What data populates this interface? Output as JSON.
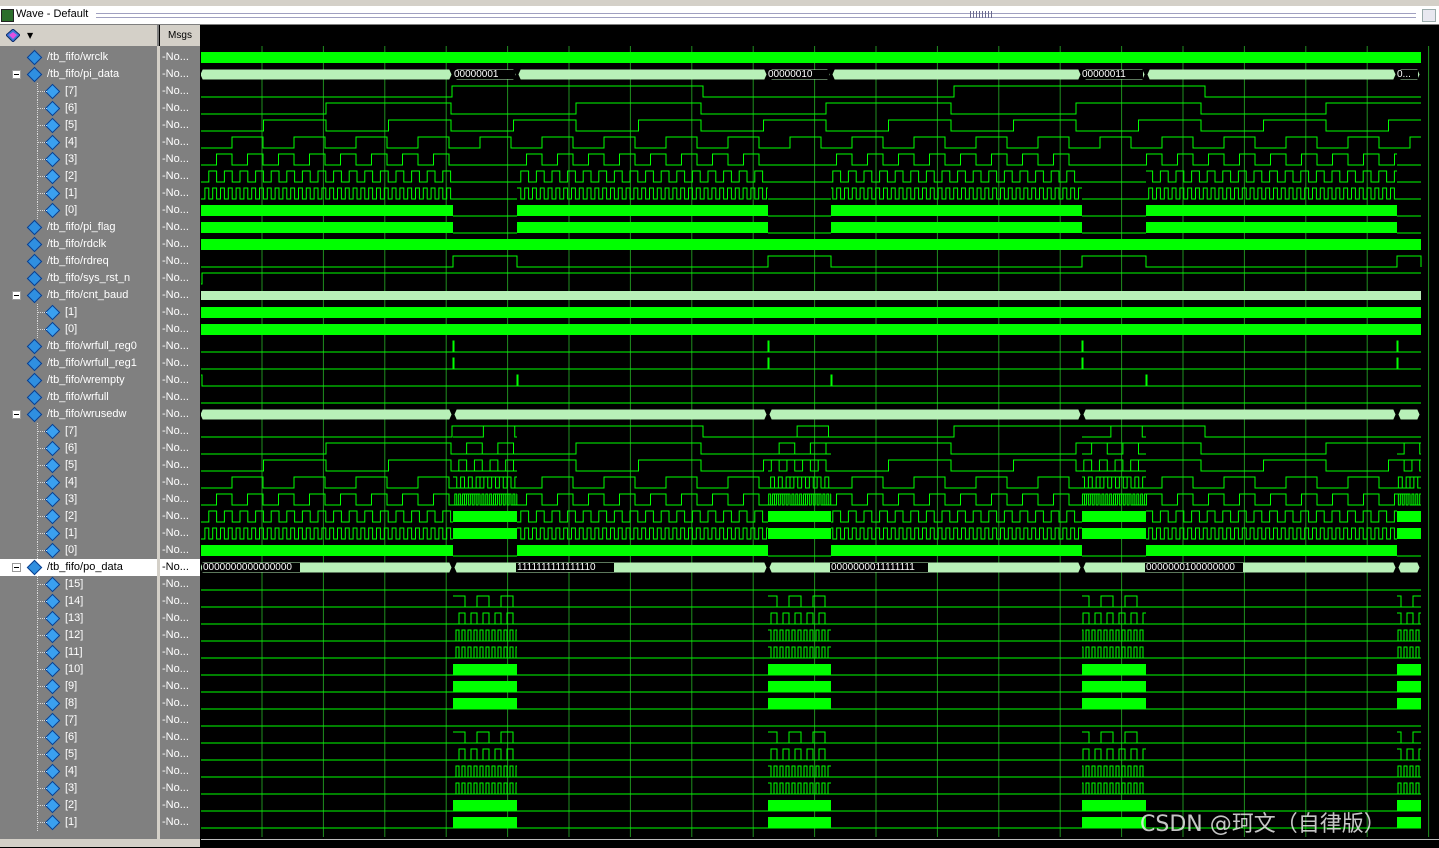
{
  "window": {
    "title": "Wave - Default"
  },
  "toolbar": {
    "msgs_header": "Msgs",
    "icon": "wave-tool-icon"
  },
  "signals": [
    {
      "name": "/tb_fifo/wrclk",
      "value": "-No...",
      "level": 0,
      "expandable": false
    },
    {
      "name": "/tb_fifo/pi_data",
      "value": "-No...",
      "level": 0,
      "expandable": true
    },
    {
      "name": "[7]",
      "value": "-No...",
      "level": 1
    },
    {
      "name": "[6]",
      "value": "-No...",
      "level": 1
    },
    {
      "name": "[5]",
      "value": "-No...",
      "level": 1
    },
    {
      "name": "[4]",
      "value": "-No...",
      "level": 1
    },
    {
      "name": "[3]",
      "value": "-No...",
      "level": 1
    },
    {
      "name": "[2]",
      "value": "-No...",
      "level": 1
    },
    {
      "name": "[1]",
      "value": "-No...",
      "level": 1
    },
    {
      "name": "[0]",
      "value": "-No...",
      "level": 1
    },
    {
      "name": "/tb_fifo/pi_flag",
      "value": "-No...",
      "level": 0
    },
    {
      "name": "/tb_fifo/rdclk",
      "value": "-No...",
      "level": 0
    },
    {
      "name": "/tb_fifo/rdreq",
      "value": "-No...",
      "level": 0
    },
    {
      "name": "/tb_fifo/sys_rst_n",
      "value": "-No...",
      "level": 0
    },
    {
      "name": "/tb_fifo/cnt_baud",
      "value": "-No...",
      "level": 0,
      "expandable": true
    },
    {
      "name": "[1]",
      "value": "-No...",
      "level": 1
    },
    {
      "name": "[0]",
      "value": "-No...",
      "level": 1
    },
    {
      "name": "/tb_fifo/wrfull_reg0",
      "value": "-No...",
      "level": 0
    },
    {
      "name": "/tb_fifo/wrfull_reg1",
      "value": "-No...",
      "level": 0
    },
    {
      "name": "/tb_fifo/wrempty",
      "value": "-No...",
      "level": 0
    },
    {
      "name": "/tb_fifo/wrfull",
      "value": "-No...",
      "level": 0
    },
    {
      "name": "/tb_fifo/wrusedw",
      "value": "-No...",
      "level": 0,
      "expandable": true
    },
    {
      "name": "[7]",
      "value": "-No...",
      "level": 1
    },
    {
      "name": "[6]",
      "value": "-No...",
      "level": 1
    },
    {
      "name": "[5]",
      "value": "-No...",
      "level": 1
    },
    {
      "name": "[4]",
      "value": "-No...",
      "level": 1
    },
    {
      "name": "[3]",
      "value": "-No...",
      "level": 1
    },
    {
      "name": "[2]",
      "value": "-No...",
      "level": 1
    },
    {
      "name": "[1]",
      "value": "-No...",
      "level": 1
    },
    {
      "name": "[0]",
      "value": "-No...",
      "level": 1
    },
    {
      "name": "/tb_fifo/po_data",
      "value": "-No...",
      "level": 0,
      "expandable": true,
      "selected": true
    },
    {
      "name": "[15]",
      "value": "-No...",
      "level": 1
    },
    {
      "name": "[14]",
      "value": "-No...",
      "level": 1
    },
    {
      "name": "[13]",
      "value": "-No...",
      "level": 1
    },
    {
      "name": "[12]",
      "value": "-No...",
      "level": 1
    },
    {
      "name": "[11]",
      "value": "-No...",
      "level": 1
    },
    {
      "name": "[10]",
      "value": "-No...",
      "level": 1
    },
    {
      "name": "[9]",
      "value": "-No...",
      "level": 1
    },
    {
      "name": "[8]",
      "value": "-No...",
      "level": 1
    },
    {
      "name": "[7]",
      "value": "-No...",
      "level": 1
    },
    {
      "name": "[6]",
      "value": "-No...",
      "level": 1
    },
    {
      "name": "[5]",
      "value": "-No...",
      "level": 1
    },
    {
      "name": "[4]",
      "value": "-No...",
      "level": 1
    },
    {
      "name": "[3]",
      "value": "-No...",
      "level": 1
    },
    {
      "name": "[2]",
      "value": "-No...",
      "level": 1
    },
    {
      "name": "[1]",
      "value": "-No...",
      "level": 1
    }
  ],
  "bus_values": {
    "pi_data": [
      "00000001",
      "00000010",
      "00000011",
      "0..."
    ],
    "po_data": [
      "0000000000000000",
      "1111111111111110",
      "0000000011111111",
      "0000000100000000"
    ]
  },
  "colors": {
    "wave": "#00ff00",
    "bus": "#b8f0b8",
    "grid": "#1f8f1f",
    "background": "#000000",
    "pane": "#808080"
  },
  "watermark": "CSDN @珂文（自律版）"
}
